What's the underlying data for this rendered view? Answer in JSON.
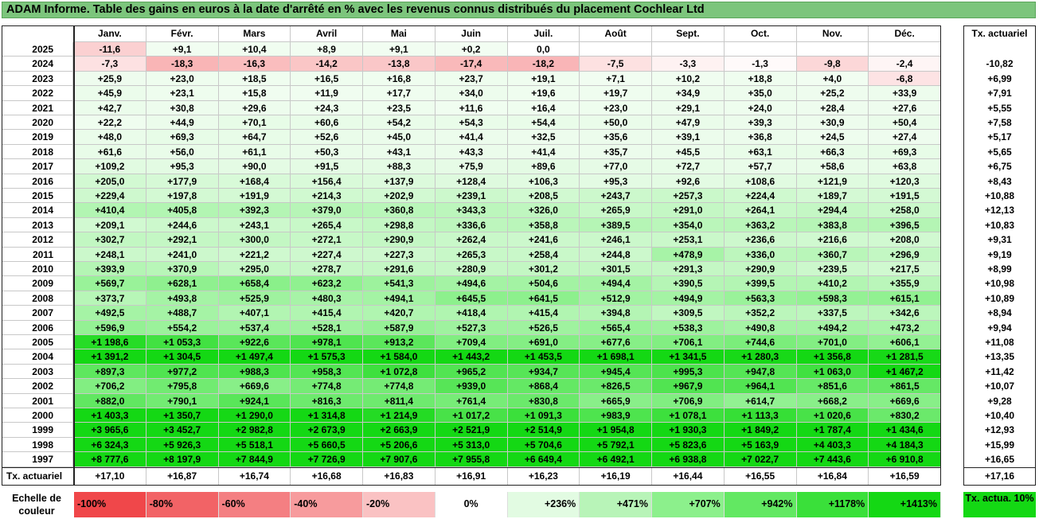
{
  "title": "ADAM Informe. Table des gains en euros à la date d'arrêté en % avec les revenus connus distribués du placement Cochlear Ltd",
  "chart_data": {
    "type": "table",
    "columns": [
      "Janv.",
      "Févr.",
      "Mars",
      "Avril",
      "Mai",
      "Juin",
      "Juil.",
      "Août",
      "Sept.",
      "Oct.",
      "Nov.",
      "Déc."
    ],
    "rate_header": "Tx. actuariel",
    "rows": [
      {
        "year": "2025",
        "values": [
          "-11,6",
          "+9,1",
          "+10,4",
          "+8,9",
          "+9,1",
          "+0,2",
          "0,0",
          "",
          "",
          "",
          "",
          ""
        ],
        "rate": ""
      },
      {
        "year": "2024",
        "values": [
          "-7,3",
          "-18,3",
          "-16,3",
          "-14,2",
          "-13,8",
          "-17,4",
          "-18,2",
          "-7,5",
          "-3,3",
          "-1,3",
          "-9,8",
          "-2,4"
        ],
        "rate": "-10,82"
      },
      {
        "year": "2023",
        "values": [
          "+25,9",
          "+23,0",
          "+18,5",
          "+16,5",
          "+16,8",
          "+23,7",
          "+19,1",
          "+7,1",
          "+10,2",
          "+18,8",
          "+4,0",
          "-6,8"
        ],
        "rate": "+6,99"
      },
      {
        "year": "2022",
        "values": [
          "+45,9",
          "+23,1",
          "+15,8",
          "+11,9",
          "+17,7",
          "+34,0",
          "+19,6",
          "+19,7",
          "+34,9",
          "+35,0",
          "+25,2",
          "+33,9"
        ],
        "rate": "+7,91"
      },
      {
        "year": "2021",
        "values": [
          "+42,7",
          "+30,8",
          "+29,6",
          "+24,3",
          "+23,5",
          "+11,6",
          "+16,4",
          "+23,0",
          "+29,1",
          "+24,0",
          "+28,4",
          "+27,6"
        ],
        "rate": "+5,55"
      },
      {
        "year": "2020",
        "values": [
          "+22,2",
          "+44,9",
          "+70,1",
          "+60,6",
          "+54,2",
          "+54,3",
          "+54,4",
          "+50,0",
          "+47,9",
          "+39,3",
          "+30,9",
          "+50,4"
        ],
        "rate": "+7,58"
      },
      {
        "year": "2019",
        "values": [
          "+48,0",
          "+69,3",
          "+64,7",
          "+52,6",
          "+45,0",
          "+41,4",
          "+32,5",
          "+35,6",
          "+39,1",
          "+36,8",
          "+24,5",
          "+27,4"
        ],
        "rate": "+5,17"
      },
      {
        "year": "2018",
        "values": [
          "+61,6",
          "+56,0",
          "+61,1",
          "+50,3",
          "+43,1",
          "+43,3",
          "+41,4",
          "+35,7",
          "+45,5",
          "+63,1",
          "+66,3",
          "+69,3"
        ],
        "rate": "+5,65"
      },
      {
        "year": "2017",
        "values": [
          "+109,2",
          "+95,3",
          "+90,0",
          "+91,5",
          "+88,3",
          "+75,9",
          "+89,6",
          "+77,0",
          "+72,7",
          "+57,7",
          "+58,6",
          "+63,8"
        ],
        "rate": "+6,75"
      },
      {
        "year": "2016",
        "values": [
          "+205,0",
          "+177,9",
          "+168,4",
          "+156,4",
          "+137,9",
          "+128,4",
          "+106,3",
          "+95,3",
          "+92,6",
          "+108,6",
          "+121,9",
          "+120,3"
        ],
        "rate": "+8,43"
      },
      {
        "year": "2015",
        "values": [
          "+229,4",
          "+197,8",
          "+191,9",
          "+214,3",
          "+202,9",
          "+239,1",
          "+208,5",
          "+243,7",
          "+257,3",
          "+224,4",
          "+189,7",
          "+191,5"
        ],
        "rate": "+10,88"
      },
      {
        "year": "2014",
        "values": [
          "+410,4",
          "+405,8",
          "+392,3",
          "+379,0",
          "+360,8",
          "+343,3",
          "+326,0",
          "+265,9",
          "+291,0",
          "+264,1",
          "+294,4",
          "+258,0"
        ],
        "rate": "+12,13"
      },
      {
        "year": "2013",
        "values": [
          "+209,1",
          "+244,6",
          "+243,1",
          "+265,4",
          "+298,8",
          "+336,6",
          "+358,8",
          "+389,5",
          "+354,0",
          "+363,2",
          "+383,8",
          "+396,5"
        ],
        "rate": "+10,83"
      },
      {
        "year": "2012",
        "values": [
          "+302,7",
          "+292,1",
          "+300,0",
          "+272,1",
          "+290,9",
          "+262,4",
          "+241,6",
          "+246,1",
          "+253,1",
          "+236,6",
          "+216,6",
          "+208,0"
        ],
        "rate": "+9,31"
      },
      {
        "year": "2011",
        "values": [
          "+248,1",
          "+241,0",
          "+221,2",
          "+227,4",
          "+227,3",
          "+265,3",
          "+258,4",
          "+244,8",
          "+478,9",
          "+336,0",
          "+360,7",
          "+296,9"
        ],
        "rate": "+9,19"
      },
      {
        "year": "2010",
        "values": [
          "+393,9",
          "+370,9",
          "+295,0",
          "+278,7",
          "+291,6",
          "+280,9",
          "+301,2",
          "+301,5",
          "+291,3",
          "+290,9",
          "+239,5",
          "+217,5"
        ],
        "rate": "+8,99"
      },
      {
        "year": "2009",
        "values": [
          "+569,7",
          "+628,1",
          "+658,4",
          "+623,2",
          "+541,3",
          "+494,6",
          "+504,6",
          "+494,4",
          "+390,5",
          "+399,5",
          "+410,2",
          "+355,9"
        ],
        "rate": "+10,98"
      },
      {
        "year": "2008",
        "values": [
          "+373,7",
          "+493,8",
          "+525,9",
          "+480,3",
          "+494,1",
          "+645,5",
          "+641,5",
          "+512,9",
          "+494,9",
          "+563,3",
          "+598,3",
          "+615,1"
        ],
        "rate": "+10,89"
      },
      {
        "year": "2007",
        "values": [
          "+492,5",
          "+488,7",
          "+407,1",
          "+415,4",
          "+420,7",
          "+418,4",
          "+415,4",
          "+394,8",
          "+309,5",
          "+352,2",
          "+337,5",
          "+342,6"
        ],
        "rate": "+8,94"
      },
      {
        "year": "2006",
        "values": [
          "+596,9",
          "+554,2",
          "+537,4",
          "+528,1",
          "+587,9",
          "+527,3",
          "+526,5",
          "+565,4",
          "+538,3",
          "+490,8",
          "+494,2",
          "+473,2"
        ],
        "rate": "+9,94"
      },
      {
        "year": "2005",
        "values": [
          "+1 198,6",
          "+1 053,3",
          "+922,6",
          "+978,1",
          "+913,2",
          "+709,4",
          "+691,0",
          "+677,6",
          "+706,1",
          "+744,6",
          "+701,0",
          "+606,1"
        ],
        "rate": "+11,08"
      },
      {
        "year": "2004",
        "values": [
          "+1 391,2",
          "+1 304,5",
          "+1 497,4",
          "+1 575,3",
          "+1 584,0",
          "+1 443,2",
          "+1 453,5",
          "+1 698,1",
          "+1 341,5",
          "+1 280,3",
          "+1 356,8",
          "+1 281,5"
        ],
        "rate": "+13,35"
      },
      {
        "year": "2003",
        "values": [
          "+897,3",
          "+977,2",
          "+988,3",
          "+958,3",
          "+1 072,8",
          "+965,2",
          "+934,7",
          "+945,4",
          "+995,3",
          "+947,8",
          "+1 063,0",
          "+1 467,2"
        ],
        "rate": "+11,42"
      },
      {
        "year": "2002",
        "values": [
          "+706,2",
          "+795,8",
          "+669,6",
          "+774,8",
          "+774,8",
          "+939,0",
          "+868,4",
          "+826,5",
          "+967,9",
          "+964,1",
          "+851,6",
          "+861,5"
        ],
        "rate": "+10,07"
      },
      {
        "year": "2001",
        "values": [
          "+882,0",
          "+790,1",
          "+924,1",
          "+816,3",
          "+811,4",
          "+761,4",
          "+830,8",
          "+665,9",
          "+706,9",
          "+614,7",
          "+668,2",
          "+669,6"
        ],
        "rate": "+9,28"
      },
      {
        "year": "2000",
        "values": [
          "+1 403,3",
          "+1 350,7",
          "+1 290,0",
          "+1 314,8",
          "+1 214,9",
          "+1 017,2",
          "+1 091,3",
          "+983,9",
          "+1 078,1",
          "+1 113,3",
          "+1 020,6",
          "+830,2"
        ],
        "rate": "+10,40"
      },
      {
        "year": "1999",
        "values": [
          "+3 965,6",
          "+3 452,7",
          "+2 982,8",
          "+2 673,9",
          "+2 663,9",
          "+2 521,9",
          "+2 514,9",
          "+1 954,8",
          "+1 930,3",
          "+1 849,2",
          "+1 787,4",
          "+1 434,6"
        ],
        "rate": "+12,93"
      },
      {
        "year": "1998",
        "values": [
          "+6 324,3",
          "+5 926,3",
          "+5 518,1",
          "+5 660,5",
          "+5 206,6",
          "+5 313,0",
          "+5 704,6",
          "+5 792,1",
          "+5 823,6",
          "+5 163,9",
          "+4 403,3",
          "+4 184,3"
        ],
        "rate": "+15,99"
      },
      {
        "year": "1997",
        "values": [
          "+8 777,6",
          "+8 197,9",
          "+7 844,9",
          "+7 726,9",
          "+7 907,6",
          "+7 955,8",
          "+6 649,4",
          "+6 492,1",
          "+6 938,8",
          "+7 022,7",
          "+7 443,6",
          "+6 910,8"
        ],
        "rate": "+16,65"
      }
    ],
    "footer": {
      "label": "Tx. actuariel",
      "values": [
        "+17,10",
        "+16,87",
        "+16,74",
        "+16,68",
        "+16,83",
        "+16,91",
        "+16,23",
        "+16,19",
        "+16,44",
        "+16,55",
        "+16,84",
        "+16,59"
      ],
      "rate": "+17,16"
    },
    "scale": {
      "label": "Echelle de couleur",
      "steps": [
        {
          "text": "-100%",
          "color": "#f0474a"
        },
        {
          "text": "-80%",
          "color": "#f26366"
        },
        {
          "text": "-60%",
          "color": "#f47f82"
        },
        {
          "text": "-40%",
          "color": "#f79b9d"
        },
        {
          "text": "-20%",
          "color": "#fac2c3"
        },
        {
          "text": "0%",
          "color": "#ffffff"
        },
        {
          "text": "+236%",
          "color": "#e2fbe2"
        },
        {
          "text": "+471%",
          "color": "#b8f4b8"
        },
        {
          "text": "+707%",
          "color": "#8cf08c"
        },
        {
          "text": "+942%",
          "color": "#62e862"
        },
        {
          "text": "+1178%",
          "color": "#3ae03a"
        },
        {
          "text": "+1413%",
          "color": "#14d814"
        }
      ],
      "rate_text": "Tx. actua. 10%",
      "rate_color": "#14d814"
    }
  }
}
